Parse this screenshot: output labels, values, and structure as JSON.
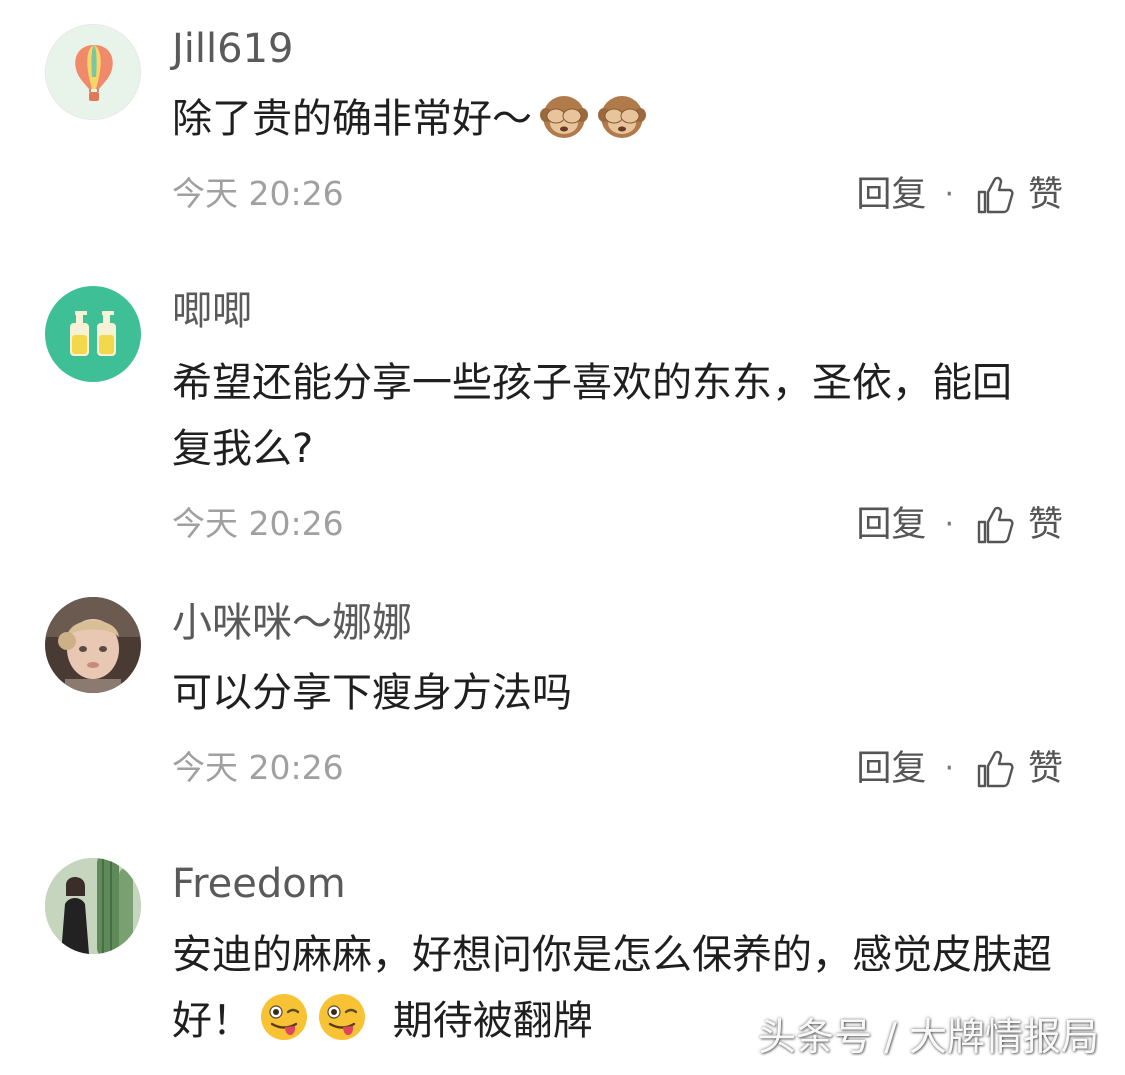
{
  "comments": [
    {
      "username": "Jill619",
      "avatar_icon": "hot-air-balloon-icon",
      "text": "除了贵的确非常好～",
      "emojis": [
        "see-no-evil-monkey",
        "see-no-evil-monkey"
      ],
      "time": "今天 20:26",
      "reply_label": "回复",
      "separator": "·",
      "like_label": "赞"
    },
    {
      "username": "唧唧",
      "avatar_icon": "bottles-icon",
      "text": "希望还能分享一些孩子喜欢的东东，圣依，能回复我么?",
      "emojis": [],
      "time": "今天 20:26",
      "reply_label": "回复",
      "separator": "·",
      "like_label": "赞"
    },
    {
      "username": "小咪咪～娜娜",
      "avatar_icon": "baby-photo",
      "text": "可以分享下瘦身方法吗",
      "emojis": [],
      "time": "今天 20:26",
      "reply_label": "回复",
      "separator": "·",
      "like_label": "赞"
    },
    {
      "username": "Freedom",
      "avatar_icon": "cactus-photo",
      "text": "安迪的麻麻，好想问你是怎么保养的，感觉皮肤超好！",
      "text_after": "期待被翻牌",
      "emojis": [
        "winking-face-with-tongue",
        "winking-face-with-tongue"
      ]
    }
  ],
  "watermark": "头条号 / 大牌情报局",
  "colors": {
    "username": "#5a5a5a",
    "text": "#1f1f1f",
    "time": "#a0a0a0",
    "actions": "#555555",
    "avatar_teal": "#3fbf95"
  }
}
